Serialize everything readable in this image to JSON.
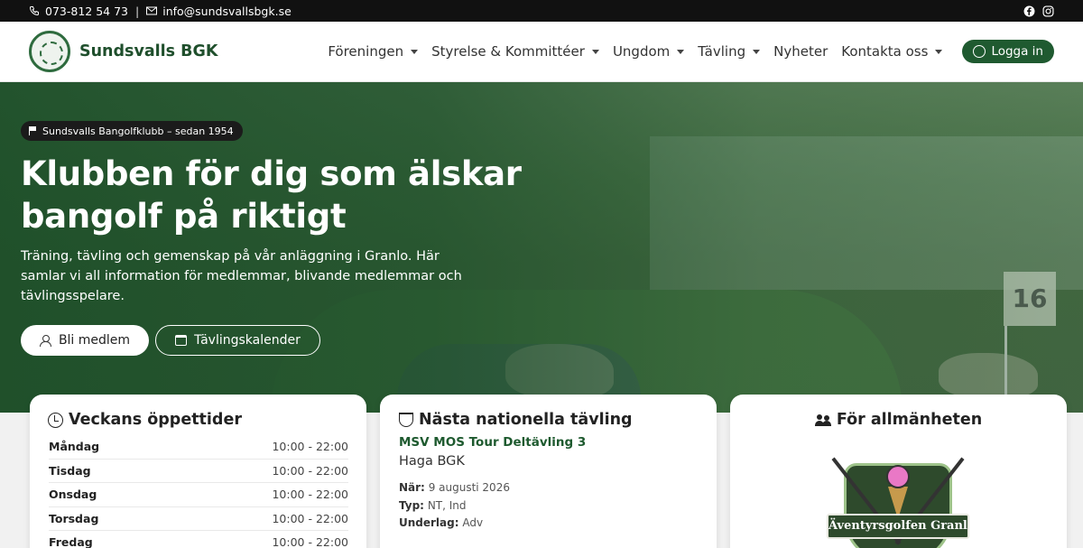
{
  "topbar": {
    "phone": "073-812 54 73",
    "separator": "|",
    "email": "info@sundsvallsbgk.se",
    "social": [
      "facebook-icon",
      "instagram-icon"
    ]
  },
  "header": {
    "brand": "Sundsvalls BGK",
    "nav": [
      {
        "label": "Föreningen",
        "dropdown": true
      },
      {
        "label": "Styrelse & Kommittéer",
        "dropdown": true
      },
      {
        "label": "Ungdom",
        "dropdown": true
      },
      {
        "label": "Tävling",
        "dropdown": true
      },
      {
        "label": "Nyheter",
        "dropdown": false
      },
      {
        "label": "Kontakta oss",
        "dropdown": true
      }
    ],
    "login_label": "Logga in"
  },
  "hero": {
    "badge": "Sundsvalls Bangolfklubb – sedan 1954",
    "title": "Klubben för dig som älskar bangolf på riktigt",
    "lead": "Träning, tävling och gemenskap på vår anläggning i Granlo. Här samlar vi all information för medlemmar, blivande medlemmar och tävlingsspelare.",
    "primary_button": "Bli medlem",
    "secondary_button": "Tävlingskalender",
    "flag_number": "16"
  },
  "hours_card": {
    "title": "Veckans öppettider",
    "rows": [
      {
        "day": "Måndag",
        "time": "10:00 - 22:00"
      },
      {
        "day": "Tisdag",
        "time": "10:00 - 22:00"
      },
      {
        "day": "Onsdag",
        "time": "10:00 - 22:00"
      },
      {
        "day": "Torsdag",
        "time": "10:00 - 22:00"
      },
      {
        "day": "Fredag",
        "time": "10:00 - 22:00"
      }
    ]
  },
  "competition_card": {
    "title": "Nästa nationella tävling",
    "name": "MSV MOS Tour Deltävling 3",
    "venue": "Haga BGK",
    "when_label": "När:",
    "when_value": "9 augusti 2026",
    "type_label": "Typ:",
    "type_value": "NT, Ind",
    "surface_label": "Underlag:",
    "surface_value": "Adv"
  },
  "public_card": {
    "title": "För allmänheten",
    "emblem_text": "Äventyrsgolfen Granlo"
  },
  "colors": {
    "brand_green": "#1f5a30",
    "topbar": "#111111",
    "accent_name": "#1e5a2f"
  }
}
